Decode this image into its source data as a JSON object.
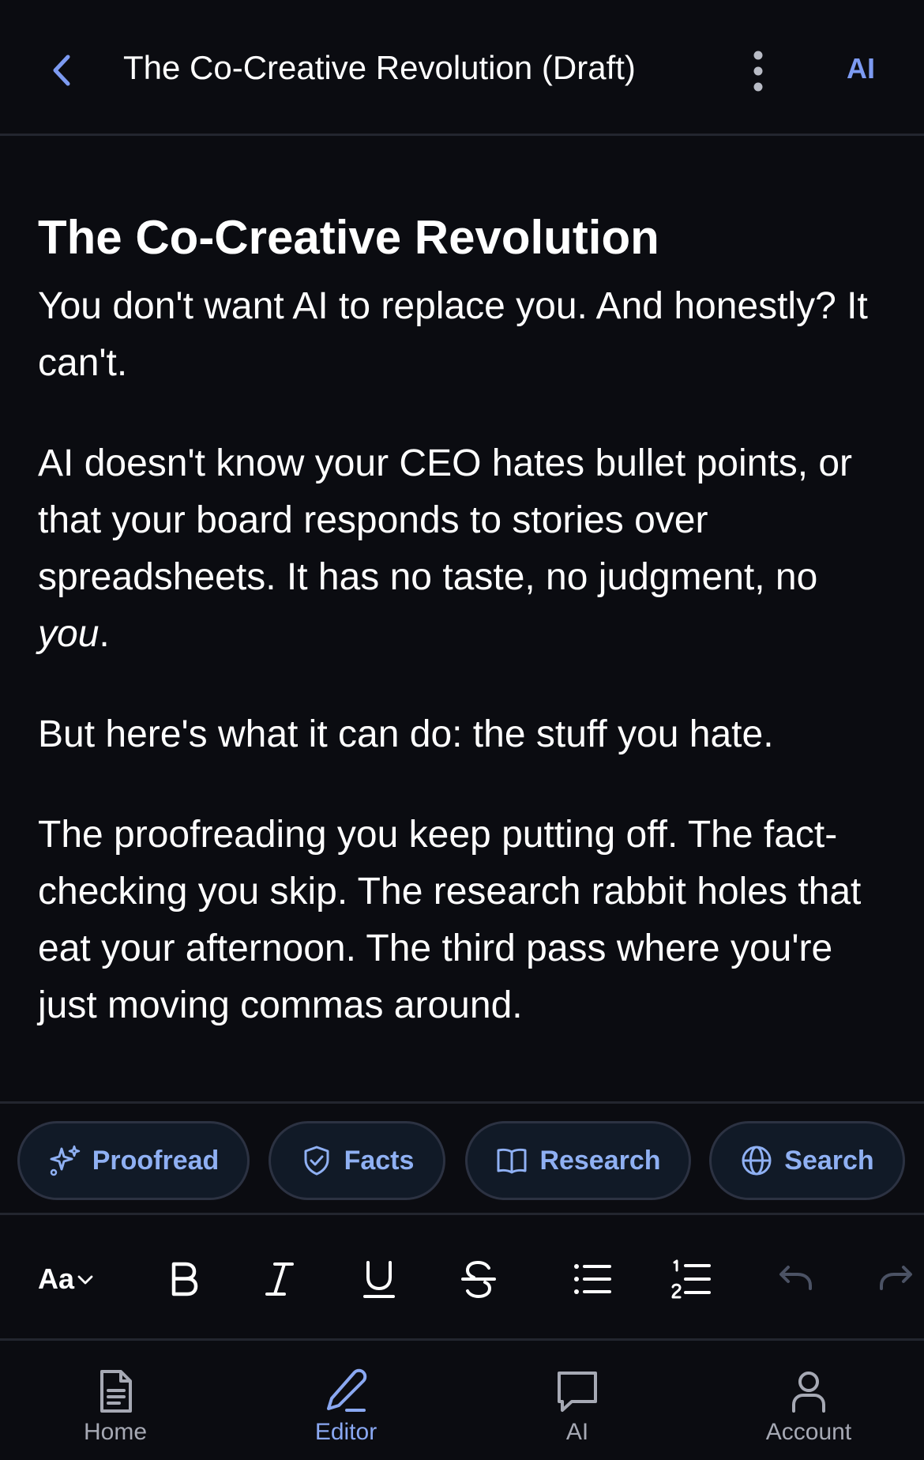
{
  "header": {
    "title": "The Co-Creative Revolution (Draft)",
    "ai_label": "AI"
  },
  "document": {
    "heading": "The Co-Creative Revolution",
    "p1": "You don't want AI to replace you. And honestly? It can't.",
    "p2": "AI doesn't know your CEO hates bullet points, or that your board responds to stories over spreadsheets. It has no taste, no judgment, no ",
    "p2_emphasis": "you",
    "p2_end": ".",
    "p3": "But here's what it can do: the stuff you hate.",
    "p4": "The proofreading you keep putting off. The fact-checking you skip. The research rabbit holes that eat your afternoon. The third pass where you're just moving commas around."
  },
  "ai_tools": {
    "proofread": "Proofread",
    "facts": "Facts",
    "research": "Research",
    "search": "Search"
  },
  "format_toolbar": {
    "font_size_label": "Aa"
  },
  "bottom_nav": {
    "home": "Home",
    "editor": "Editor",
    "ai": "AI",
    "account": "Account"
  },
  "colors": {
    "background": "#0b0c11",
    "accent": "#7d9bf2",
    "chip_text": "#8fb0f3",
    "divider": "#23262f",
    "inactive_icon": "#a6a9b4",
    "disabled_icon": "#4b5264"
  },
  "icons": {
    "back": "chevron-left-icon",
    "more": "more-vertical-icon",
    "proofread": "sparkles-icon",
    "facts": "shield-check-icon",
    "research": "book-open-icon",
    "search": "globe-icon",
    "bold": "bold-icon",
    "italic": "italic-icon",
    "underline": "underline-icon",
    "strikethrough": "strikethrough-icon",
    "bullet_list": "bullet-list-icon",
    "numbered_list": "numbered-list-icon",
    "undo": "undo-icon",
    "redo": "redo-icon",
    "home": "document-icon",
    "editor": "pencil-icon",
    "ai": "chat-bubble-icon",
    "account": "user-icon"
  }
}
